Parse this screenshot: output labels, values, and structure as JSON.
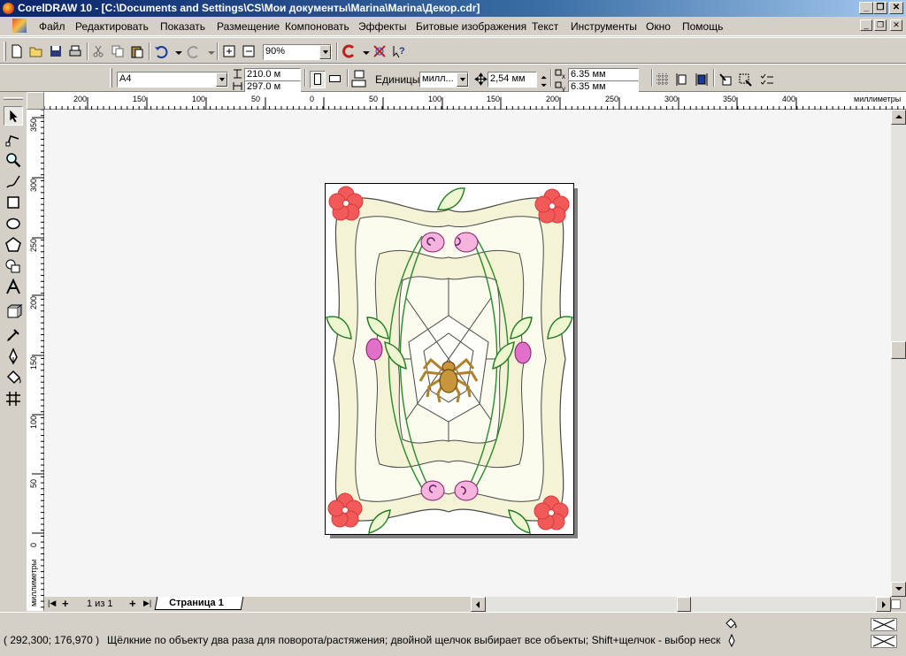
{
  "window": {
    "title": "CorelDRAW 10 - [C:\\Documents and Settings\\CS\\Мои документы\\Marina\\Marina\\Декор.cdr]"
  },
  "menu": [
    "Файл",
    "Редактировать",
    "Показать",
    "Размещение",
    "Компоновать",
    "Эффекты",
    "Битовые изображения",
    "Текст",
    "Инструменты",
    "Окно",
    "Помощь"
  ],
  "toolbar": {
    "zoom": "90%"
  },
  "propbar": {
    "paper": "A4",
    "width": "210.0 м",
    "height": "297.0 м",
    "units_label": "Единицы:",
    "units": "милл...",
    "nudge": "2,54 мм",
    "dup_x": "6.35 мм",
    "dup_y": "6.35 мм"
  },
  "ruler": {
    "h_labels": [
      "200",
      "150",
      "100",
      "50",
      "0",
      "50",
      "100",
      "150",
      "200",
      "250",
      "300",
      "350",
      "400"
    ],
    "h_unit": "миллиметры",
    "v_labels": [
      "350",
      "300",
      "250",
      "200",
      "150",
      "100",
      "50",
      "0"
    ],
    "v_unit": "миллиметры"
  },
  "pages": {
    "counter": "1 из 1",
    "tab": "Страница 1"
  },
  "status": {
    "coords": "( 292,300; 176,970 )",
    "hint": "Щёлкние по объекту два раза для поворота/растяжения; двойной щелчок выбирает все объекты; Shift+щелчок - выбор нескольких; A..."
  },
  "icons": {
    "tools": [
      "pick-tool-icon",
      "shape-tool-icon",
      "zoom-tool-icon",
      "freehand-tool-icon",
      "rectangle-tool-icon",
      "ellipse-tool-icon",
      "polygon-tool-icon",
      "basic-shapes-icon",
      "text-tool-icon",
      "interactive-fill-icon",
      "eyedropper-icon",
      "outline-pen-icon",
      "fill-bucket-icon",
      "interactive-mesh-icon"
    ]
  }
}
